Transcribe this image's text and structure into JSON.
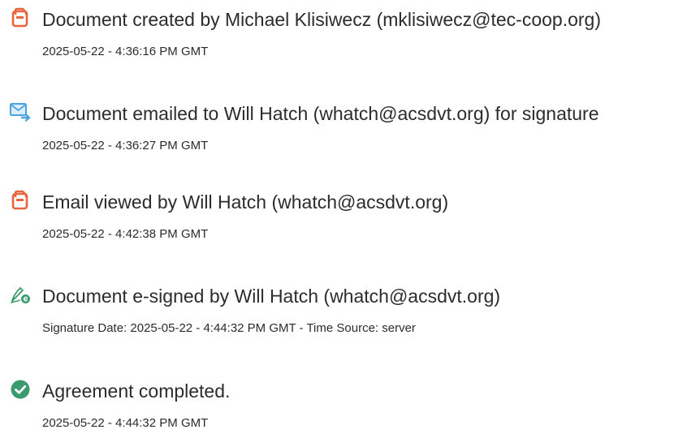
{
  "events": [
    {
      "icon": "document-created-icon",
      "title": "Document created by Michael Klisiwecz (mklisiwecz@tec-coop.org)",
      "meta": "2025-05-22 - 4:36:16 PM GMT"
    },
    {
      "icon": "email-sent-icon",
      "title": "Document emailed to Will Hatch (whatch@acsdvt.org) for signature",
      "meta": "2025-05-22 - 4:36:27 PM GMT"
    },
    {
      "icon": "email-viewed-icon",
      "title": "Email viewed by Will Hatch (whatch@acsdvt.org)",
      "meta": "2025-05-22 - 4:42:38 PM GMT"
    },
    {
      "icon": "e-signed-icon",
      "title": "Document e-signed by Will Hatch (whatch@acsdvt.org)",
      "meta": "Signature Date: 2025-05-22 - 4:44:32 PM GMT - Time Source: server"
    },
    {
      "icon": "completed-check-icon",
      "title": "Agreement completed.",
      "meta": "2025-05-22 - 4:44:32 PM GMT"
    }
  ],
  "colors": {
    "doc_icon": "#e8643c",
    "mail_icon": "#4aa3df",
    "sign_icon": "#3a9b6e",
    "check_icon": "#3a9b6e",
    "text": "#2c2c2c"
  }
}
